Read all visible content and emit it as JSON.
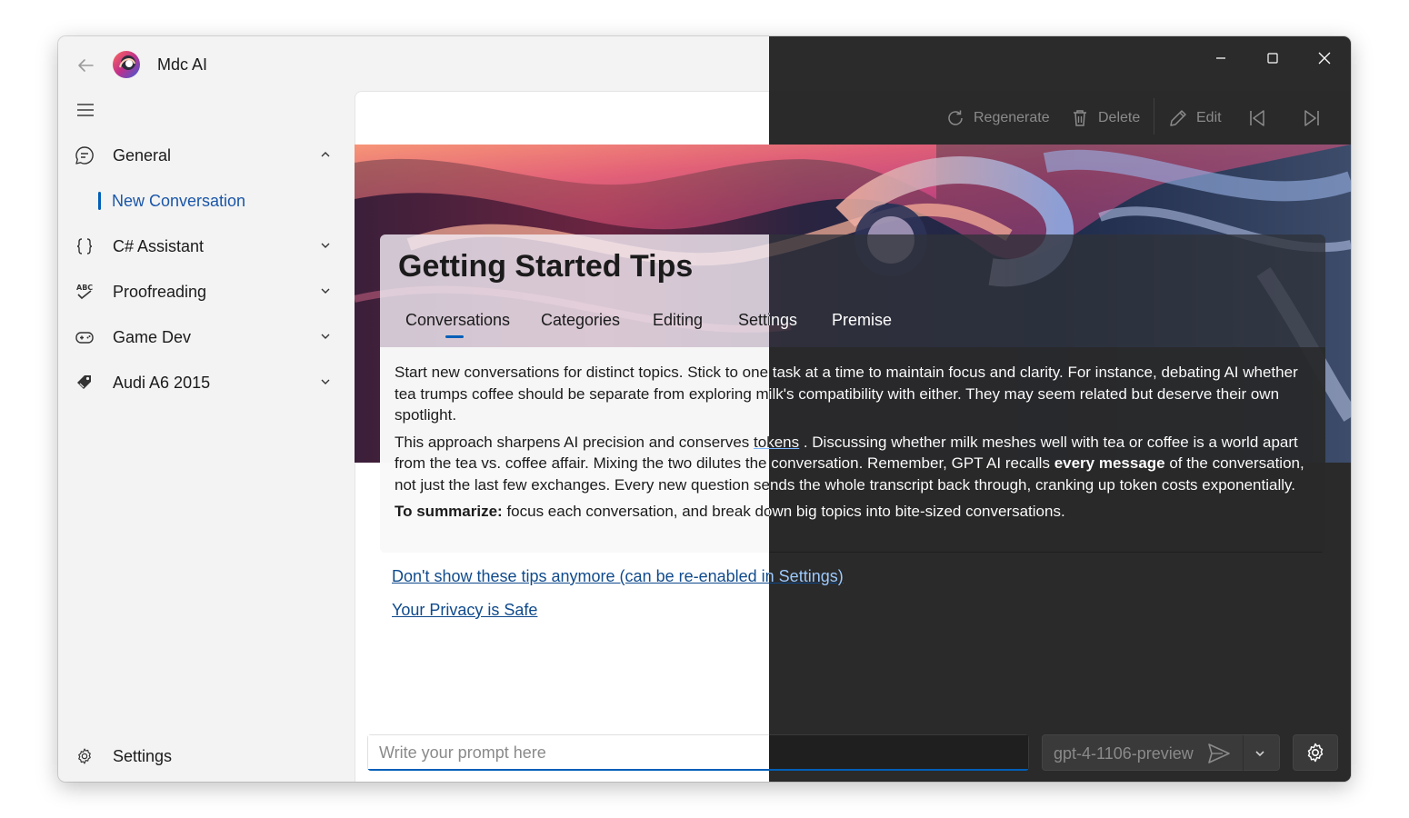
{
  "app": {
    "title": "Mdc AI",
    "logo_icon": "mdc-ai-logo"
  },
  "window_controls": {
    "minimize_icon": "minimize-icon",
    "maximize_icon": "maximize-icon",
    "close_icon": "close-icon"
  },
  "sidebar": {
    "menu_icon": "hamburger-menu-icon",
    "items": [
      {
        "label": "General",
        "icon": "chat-bubble-icon",
        "expanded": true
      },
      {
        "label": "New Conversation",
        "selected": true
      },
      {
        "label": "C# Assistant",
        "icon": "braces-icon",
        "expanded": false
      },
      {
        "label": "Proofreading",
        "icon": "spellcheck-icon",
        "expanded": false
      },
      {
        "label": "Game Dev",
        "icon": "gamepad-icon",
        "expanded": false
      },
      {
        "label": "Audi A6 2015",
        "icon": "tag-icon",
        "expanded": false
      }
    ],
    "settings_label": "Settings"
  },
  "toolbar": {
    "regenerate_label": "Regenerate",
    "delete_label": "Delete",
    "edit_label": "Edit",
    "first_icon": "skip-first-icon",
    "last_icon": "skip-last-icon"
  },
  "tips": {
    "title": "Getting Started Tips",
    "tabs": [
      "Conversations",
      "Categories",
      "Editing",
      "Settings",
      "Premise"
    ],
    "active_tab": "Conversations",
    "paragraph1": "Start new conversations for distinct topics. Stick to one task at a time to maintain focus and clarity. For instance, debating AI whether tea trumps coffee should be separate from exploring milk's compatibility with either. They may seem related but deserve their own spotlight.",
    "paragraph2_a": "This approach sharpens AI precision and conserves ",
    "paragraph2_link": "tokens",
    "paragraph2_b": " . Discussing whether milk meshes well with tea or coffee is a world apart from the tea vs. coffee affair. Mixing the two dilutes the conversation. Remember, GPT AI recalls ",
    "paragraph2_bold": "every message",
    "paragraph2_c": " of the conversation, not just the last few exchanges. Every new question sends the whole transcript back through, cranking up token costs exponentially.",
    "summary_bold": "To summarize:",
    "summary_text": " focus each conversation, and break down big topics into bite-sized conversations."
  },
  "links": {
    "dont_show": "Don't show these tips anymore (can be re-enabled in Settings)",
    "privacy": "Your Privacy is Safe"
  },
  "prompt": {
    "placeholder": "Write your prompt here",
    "model": "gpt-4-1106-preview"
  },
  "colors": {
    "accent": "#005fb8",
    "link_light": "#0f4a8c",
    "link_dark": "#9ecbff",
    "dark_bg": "#2b2b2b",
    "light_bg": "#f3f3f3"
  }
}
